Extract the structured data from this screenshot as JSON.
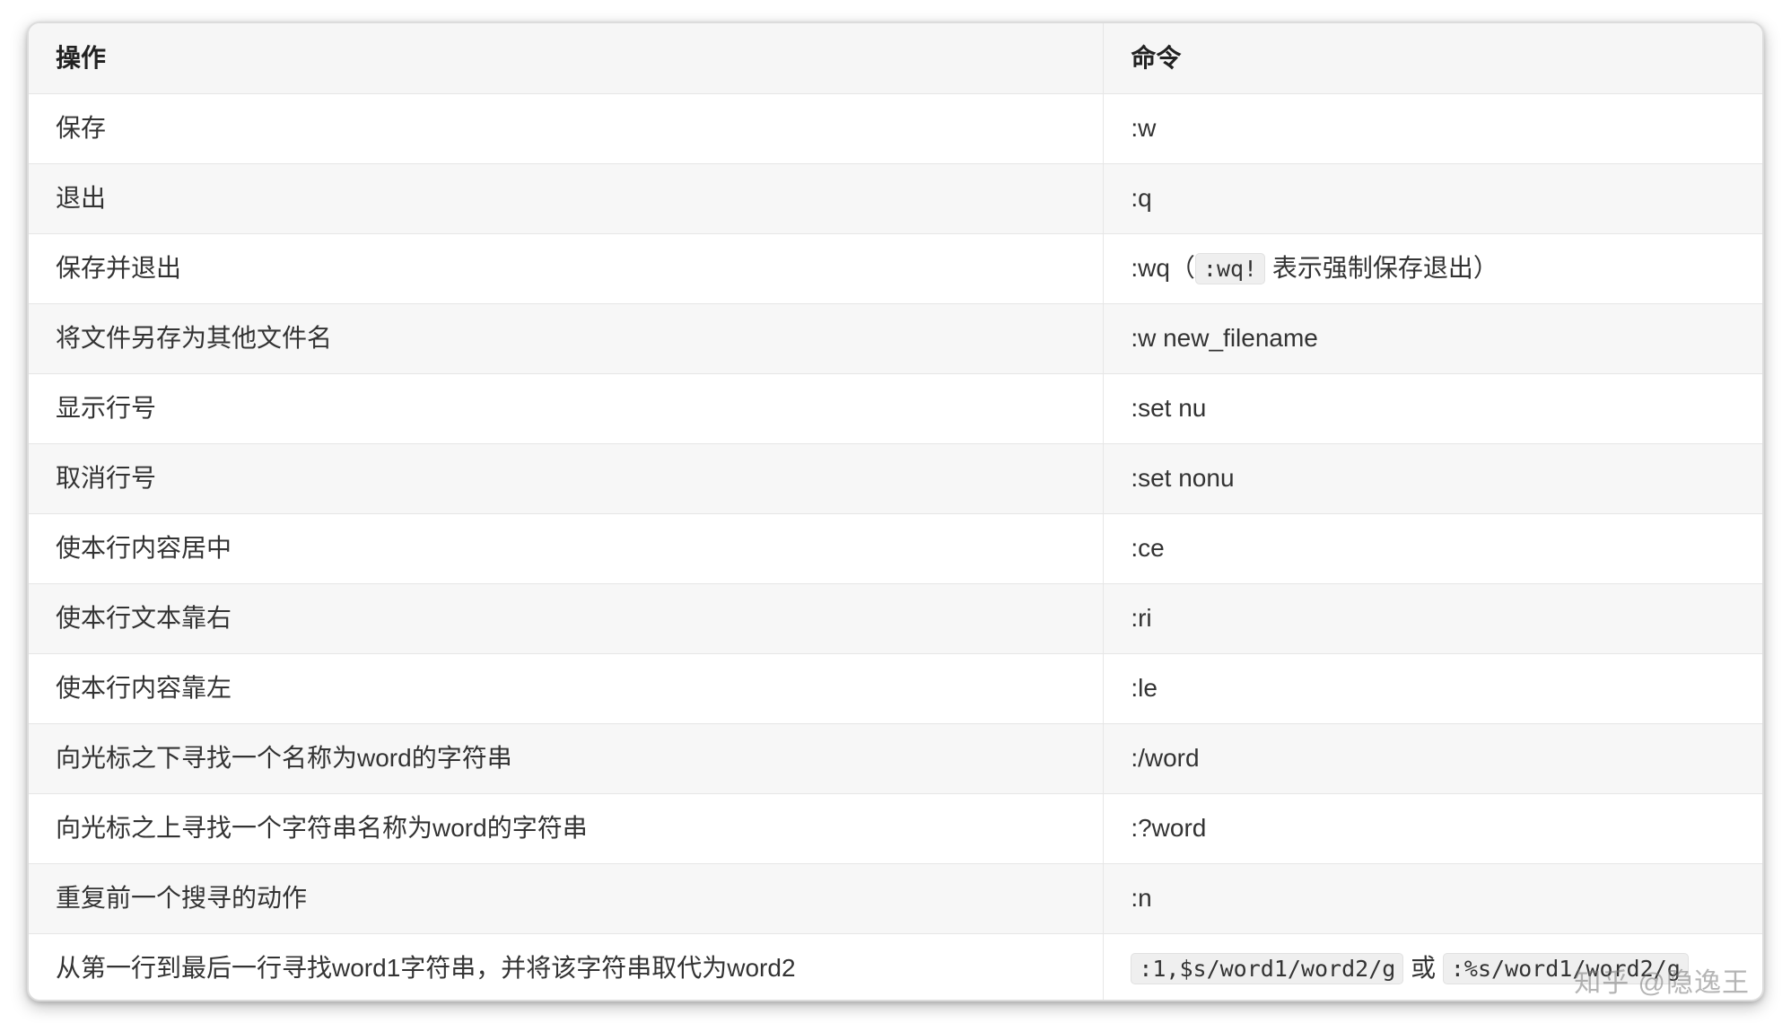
{
  "headers": {
    "operation": "操作",
    "command": "命令"
  },
  "rows": [
    {
      "op": "保存",
      "cmd": [
        {
          "t": "text",
          "v": ":w"
        }
      ]
    },
    {
      "op": "退出",
      "cmd": [
        {
          "t": "text",
          "v": ":q"
        }
      ]
    },
    {
      "op": "保存并退出",
      "cmd": [
        {
          "t": "text",
          "v": ":wq（"
        },
        {
          "t": "code",
          "v": ":wq!"
        },
        {
          "t": "text",
          "v": " 表示强制保存退出）"
        }
      ]
    },
    {
      "op": "将文件另存为其他文件名",
      "cmd": [
        {
          "t": "text",
          "v": ":w new_filename"
        }
      ]
    },
    {
      "op": "显示行号",
      "cmd": [
        {
          "t": "text",
          "v": ":set nu"
        }
      ]
    },
    {
      "op": "取消行号",
      "cmd": [
        {
          "t": "text",
          "v": ":set nonu"
        }
      ]
    },
    {
      "op": "使本行内容居中",
      "cmd": [
        {
          "t": "text",
          "v": ":ce"
        }
      ]
    },
    {
      "op": "使本行文本靠右",
      "cmd": [
        {
          "t": "text",
          "v": ":ri"
        }
      ]
    },
    {
      "op": "使本行内容靠左",
      "cmd": [
        {
          "t": "text",
          "v": ":le"
        }
      ]
    },
    {
      "op": "向光标之下寻找一个名称为word的字符串",
      "cmd": [
        {
          "t": "text",
          "v": ":/word"
        }
      ]
    },
    {
      "op": "向光标之上寻找一个字符串名称为word的字符串",
      "cmd": [
        {
          "t": "text",
          "v": ":?word"
        }
      ]
    },
    {
      "op": "重复前一个搜寻的动作",
      "cmd": [
        {
          "t": "text",
          "v": ":n"
        }
      ]
    },
    {
      "op": "从第一行到最后一行寻找word1字符串，并将该字符串取代为word2",
      "cmd": [
        {
          "t": "code",
          "v": ":1,$s/word1/word2/g"
        },
        {
          "t": "text",
          "v": " 或 "
        },
        {
          "t": "code",
          "v": ":%s/word1/word2/g"
        }
      ]
    }
  ],
  "watermark": "知乎 @隐逸王"
}
